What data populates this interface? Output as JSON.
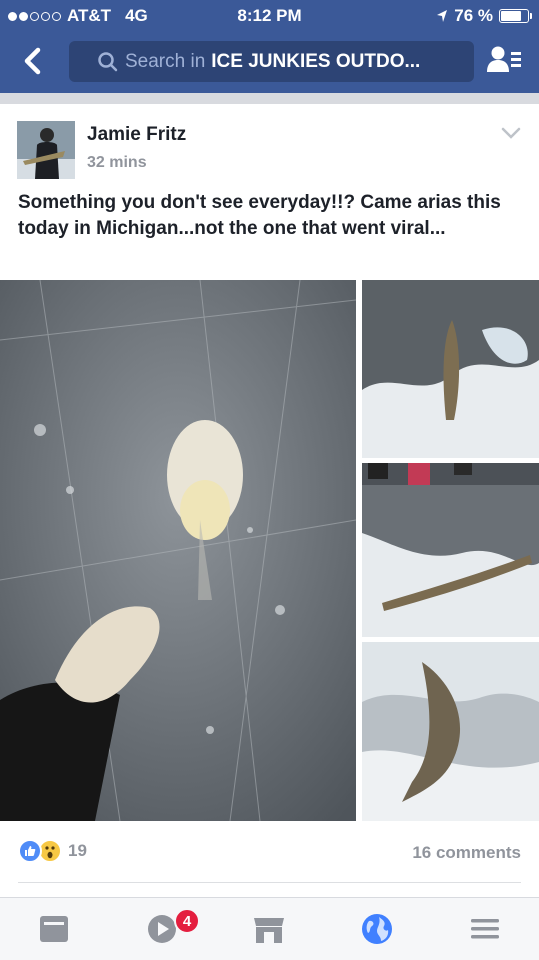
{
  "status_bar": {
    "carrier": "AT&T",
    "network": "4G",
    "time": "8:12 PM",
    "battery": "76 %"
  },
  "header": {
    "search_placeholder": "Search in",
    "search_group": "ICE JUNKIES OUTDO...",
    "icons": [
      "back-icon",
      "search-icon",
      "friends-icon"
    ]
  },
  "post": {
    "author": "Jamie Fritz",
    "time": "32 mins",
    "text": "Something you don't see everyday!!? Came arias this today in Michigan...not the one that went viral...",
    "reaction_count": "19",
    "comments": "16 comments"
  },
  "tabbar": {
    "video_badge": "4",
    "icons": [
      "news-feed-icon",
      "video-icon",
      "marketplace-icon",
      "globe-icon",
      "menu-icon"
    ]
  },
  "colors": {
    "brand": "#3b5998",
    "active_tab": "#4080ff",
    "badge": "#e41e3f"
  }
}
